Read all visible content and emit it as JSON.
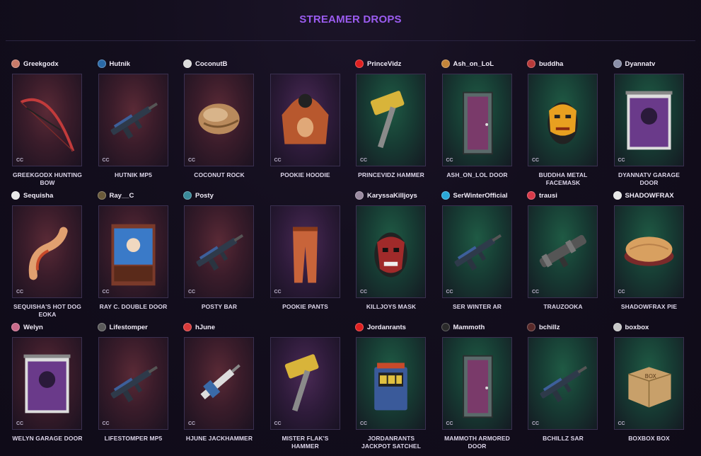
{
  "title": "STREAMER DROPS",
  "badge": "CC",
  "items": [
    {
      "streamer": "Greekgodx",
      "item": "GREEKGODX HUNTING BOW",
      "theme": "red",
      "avatar": "#c97b6a",
      "icon": "bow-icon"
    },
    {
      "streamer": "Hutnik",
      "item": "HUTNIK MP5",
      "theme": "red",
      "avatar": "#2a6aa8",
      "icon": "rifle-icon"
    },
    {
      "streamer": "CoconutB",
      "item": "COCONUT ROCK",
      "theme": "red",
      "avatar": "#dcdcdc",
      "icon": "rock-icon"
    },
    {
      "streamer": "",
      "item": "POOKIE HOODIE",
      "theme": "purple",
      "avatar": "",
      "icon": "hoodie-icon"
    },
    {
      "streamer": "PrinceVidz",
      "item": "PRINCEVIDZ HAMMER",
      "theme": "green",
      "avatar": "#e02020",
      "icon": "hammer-icon"
    },
    {
      "streamer": "Ash_on_LoL",
      "item": "ASH_ON_LOL DOOR",
      "theme": "green",
      "avatar": "#c4853a",
      "icon": "door-icon"
    },
    {
      "streamer": "buddha",
      "item": "BUDDHA METAL FACEMASK",
      "theme": "green",
      "avatar": "#b83a3a",
      "icon": "facemask-icon"
    },
    {
      "streamer": "Dyannatv",
      "item": "DYANNATV GARAGE DOOR",
      "theme": "green",
      "avatar": "#8a8fa8",
      "icon": "garage-door-icon"
    },
    {
      "streamer": "Sequisha",
      "item": "SEQUISHA'S HOT DOG EOKA",
      "theme": "red",
      "avatar": "#e8e8e8",
      "icon": "hotdog-icon"
    },
    {
      "streamer": "Ray__C",
      "item": "RAY C. DOUBLE DOOR",
      "theme": "red",
      "avatar": "#6a5a3a",
      "icon": "double-door-icon"
    },
    {
      "streamer": "Posty",
      "item": "POSTY BAR",
      "theme": "red",
      "avatar": "#3a8a9a",
      "icon": "rifle-icon"
    },
    {
      "streamer": "",
      "item": "POOKIE PANTS",
      "theme": "purple",
      "avatar": "",
      "icon": "pants-icon"
    },
    {
      "streamer": "KaryssaKilljoys",
      "item": "KILLJOYS MASK",
      "theme": "green",
      "avatar": "#9a8aa0",
      "icon": "mask-icon"
    },
    {
      "streamer": "SerWinterOfficial",
      "item": "SER WINTER AR",
      "theme": "green",
      "avatar": "#2aa8d8",
      "icon": "rifle-icon"
    },
    {
      "streamer": "trausi",
      "item": "TRAUZOOKA",
      "theme": "green",
      "avatar": "#d83a4a",
      "icon": "launcher-icon"
    },
    {
      "streamer": "SHADOWFRAX",
      "item": "SHADOWFRAX PIE",
      "theme": "green",
      "avatar": "#e8e8e8",
      "icon": "pie-icon"
    },
    {
      "streamer": "Welyn",
      "item": "WELYN GARAGE DOOR",
      "theme": "red",
      "avatar": "#c86a8a",
      "icon": "garage-door-icon"
    },
    {
      "streamer": "Lifestomper",
      "item": "LIFESTOMPER MP5",
      "theme": "red",
      "avatar": "#5a5a5a",
      "icon": "rifle-icon"
    },
    {
      "streamer": "hJune",
      "item": "HJUNE JACKHAMMER",
      "theme": "red",
      "avatar": "#d83a3a",
      "icon": "jackhammer-icon"
    },
    {
      "streamer": "",
      "item": "MISTER FLAK'S HAMMER",
      "theme": "purple",
      "avatar": "",
      "icon": "hammer-icon"
    },
    {
      "streamer": "Jordanrants",
      "item": "JORDANRANTS JACKPOT SATCHEL",
      "theme": "green",
      "avatar": "#e02020",
      "icon": "satchel-icon"
    },
    {
      "streamer": "Mammoth",
      "item": "MAMMOTH ARMORED DOOR",
      "theme": "green",
      "avatar": "#2a2a2a",
      "icon": "door-icon"
    },
    {
      "streamer": "bchillz",
      "item": "BCHILLZ SAR",
      "theme": "green",
      "avatar": "#5a2a2a",
      "icon": "rifle-icon"
    },
    {
      "streamer": "boxbox",
      "item": "BOXBOX BOX",
      "theme": "green",
      "avatar": "#c8c8c8",
      "icon": "box-icon"
    }
  ]
}
